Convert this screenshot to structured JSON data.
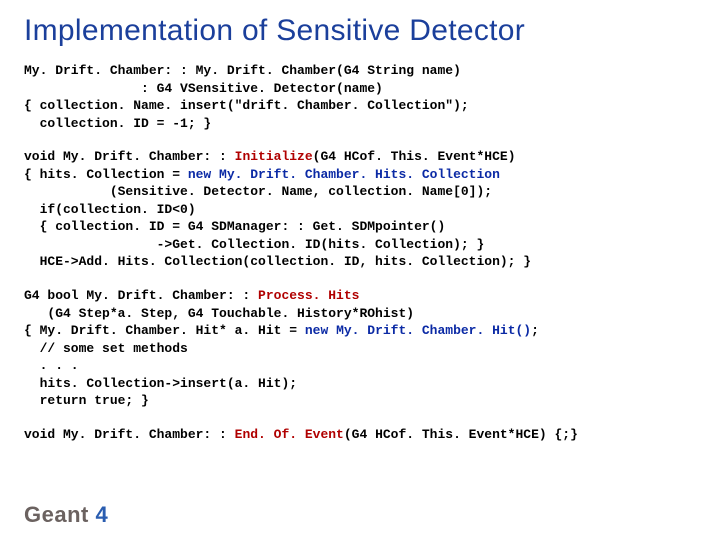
{
  "title": "Implementation of Sensitive Detector",
  "code1": {
    "l1a": "My. Drift. Chamber: : My. Drift. Chamber(G4 String name)",
    "l2": "               : G4 VSensitive. Detector(name)",
    "l3": "{ collection. Name. insert(\"drift. Chamber. Collection\");",
    "l4": "  collection. ID = -1; }"
  },
  "code2": {
    "l1a": "void My. Drift. Chamber: : ",
    "l1b": "Initialize",
    "l1c": "(G4 HCof. This. Event*HCE)",
    "l2a": "{ hits. Collection = ",
    "l2b": "new My. Drift. Chamber. Hits. Collection",
    "l3": "           (Sensitive. Detector. Name, collection. Name[0]);",
    "l4": "  if(collection. ID<0)",
    "l5": "  { collection. ID = G4 SDManager: : Get. SDMpointer()",
    "l6": "                 ->Get. Collection. ID(hits. Collection); }",
    "l7": "  HCE->Add. Hits. Collection(collection. ID, hits. Collection); }"
  },
  "code3": {
    "l1a": "G4 bool My. Drift. Chamber: : ",
    "l1b": "Process. Hits",
    "l2": "   (G4 Step*a. Step, G4 Touchable. History*ROhist)",
    "l3a": "{ My. Drift. Chamber. Hit* a. Hit = ",
    "l3b": "new My. Drift. Chamber. Hit()",
    "l3c": ";",
    "l4": "  // some set methods",
    "l5": "  . . .",
    "l6": "  hits. Collection->insert(a. Hit);",
    "l7": "  return true; }"
  },
  "code4": {
    "l1a": "void My. Drift. Chamber: : ",
    "l1b": "End. Of. Event",
    "l1c": "(G4 HCof. This. Event*HCE) {;}"
  },
  "logo": {
    "g": "Geant",
    "n": " 4"
  }
}
